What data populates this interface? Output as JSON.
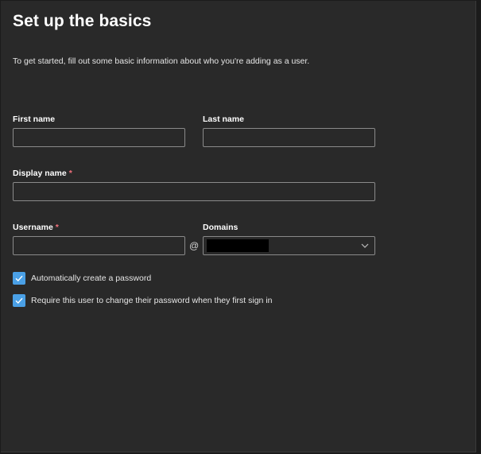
{
  "page": {
    "title": "Set up the basics",
    "subtitle": "To get started, fill out some basic information about who you're adding as a user."
  },
  "form": {
    "first_name": {
      "label": "First name",
      "value": ""
    },
    "last_name": {
      "label": "Last name",
      "value": ""
    },
    "display_name": {
      "label": "Display name",
      "required_mark": "*",
      "value": ""
    },
    "username": {
      "label": "Username",
      "required_mark": "*",
      "value": ""
    },
    "at_symbol": "@",
    "domains": {
      "label": "Domains",
      "selected": ""
    },
    "checkboxes": [
      {
        "label": "Automatically create a password",
        "checked": true
      },
      {
        "label": "Require this user to change their password when they first sign in",
        "checked": true
      }
    ]
  },
  "icons": {
    "checkbox": "checkmark-icon",
    "dropdown": "chevron-down-icon"
  },
  "colors": {
    "background": "#292929",
    "accent": "#4aa0e6",
    "required": "#f1707b",
    "border": "#8a8a8a"
  }
}
